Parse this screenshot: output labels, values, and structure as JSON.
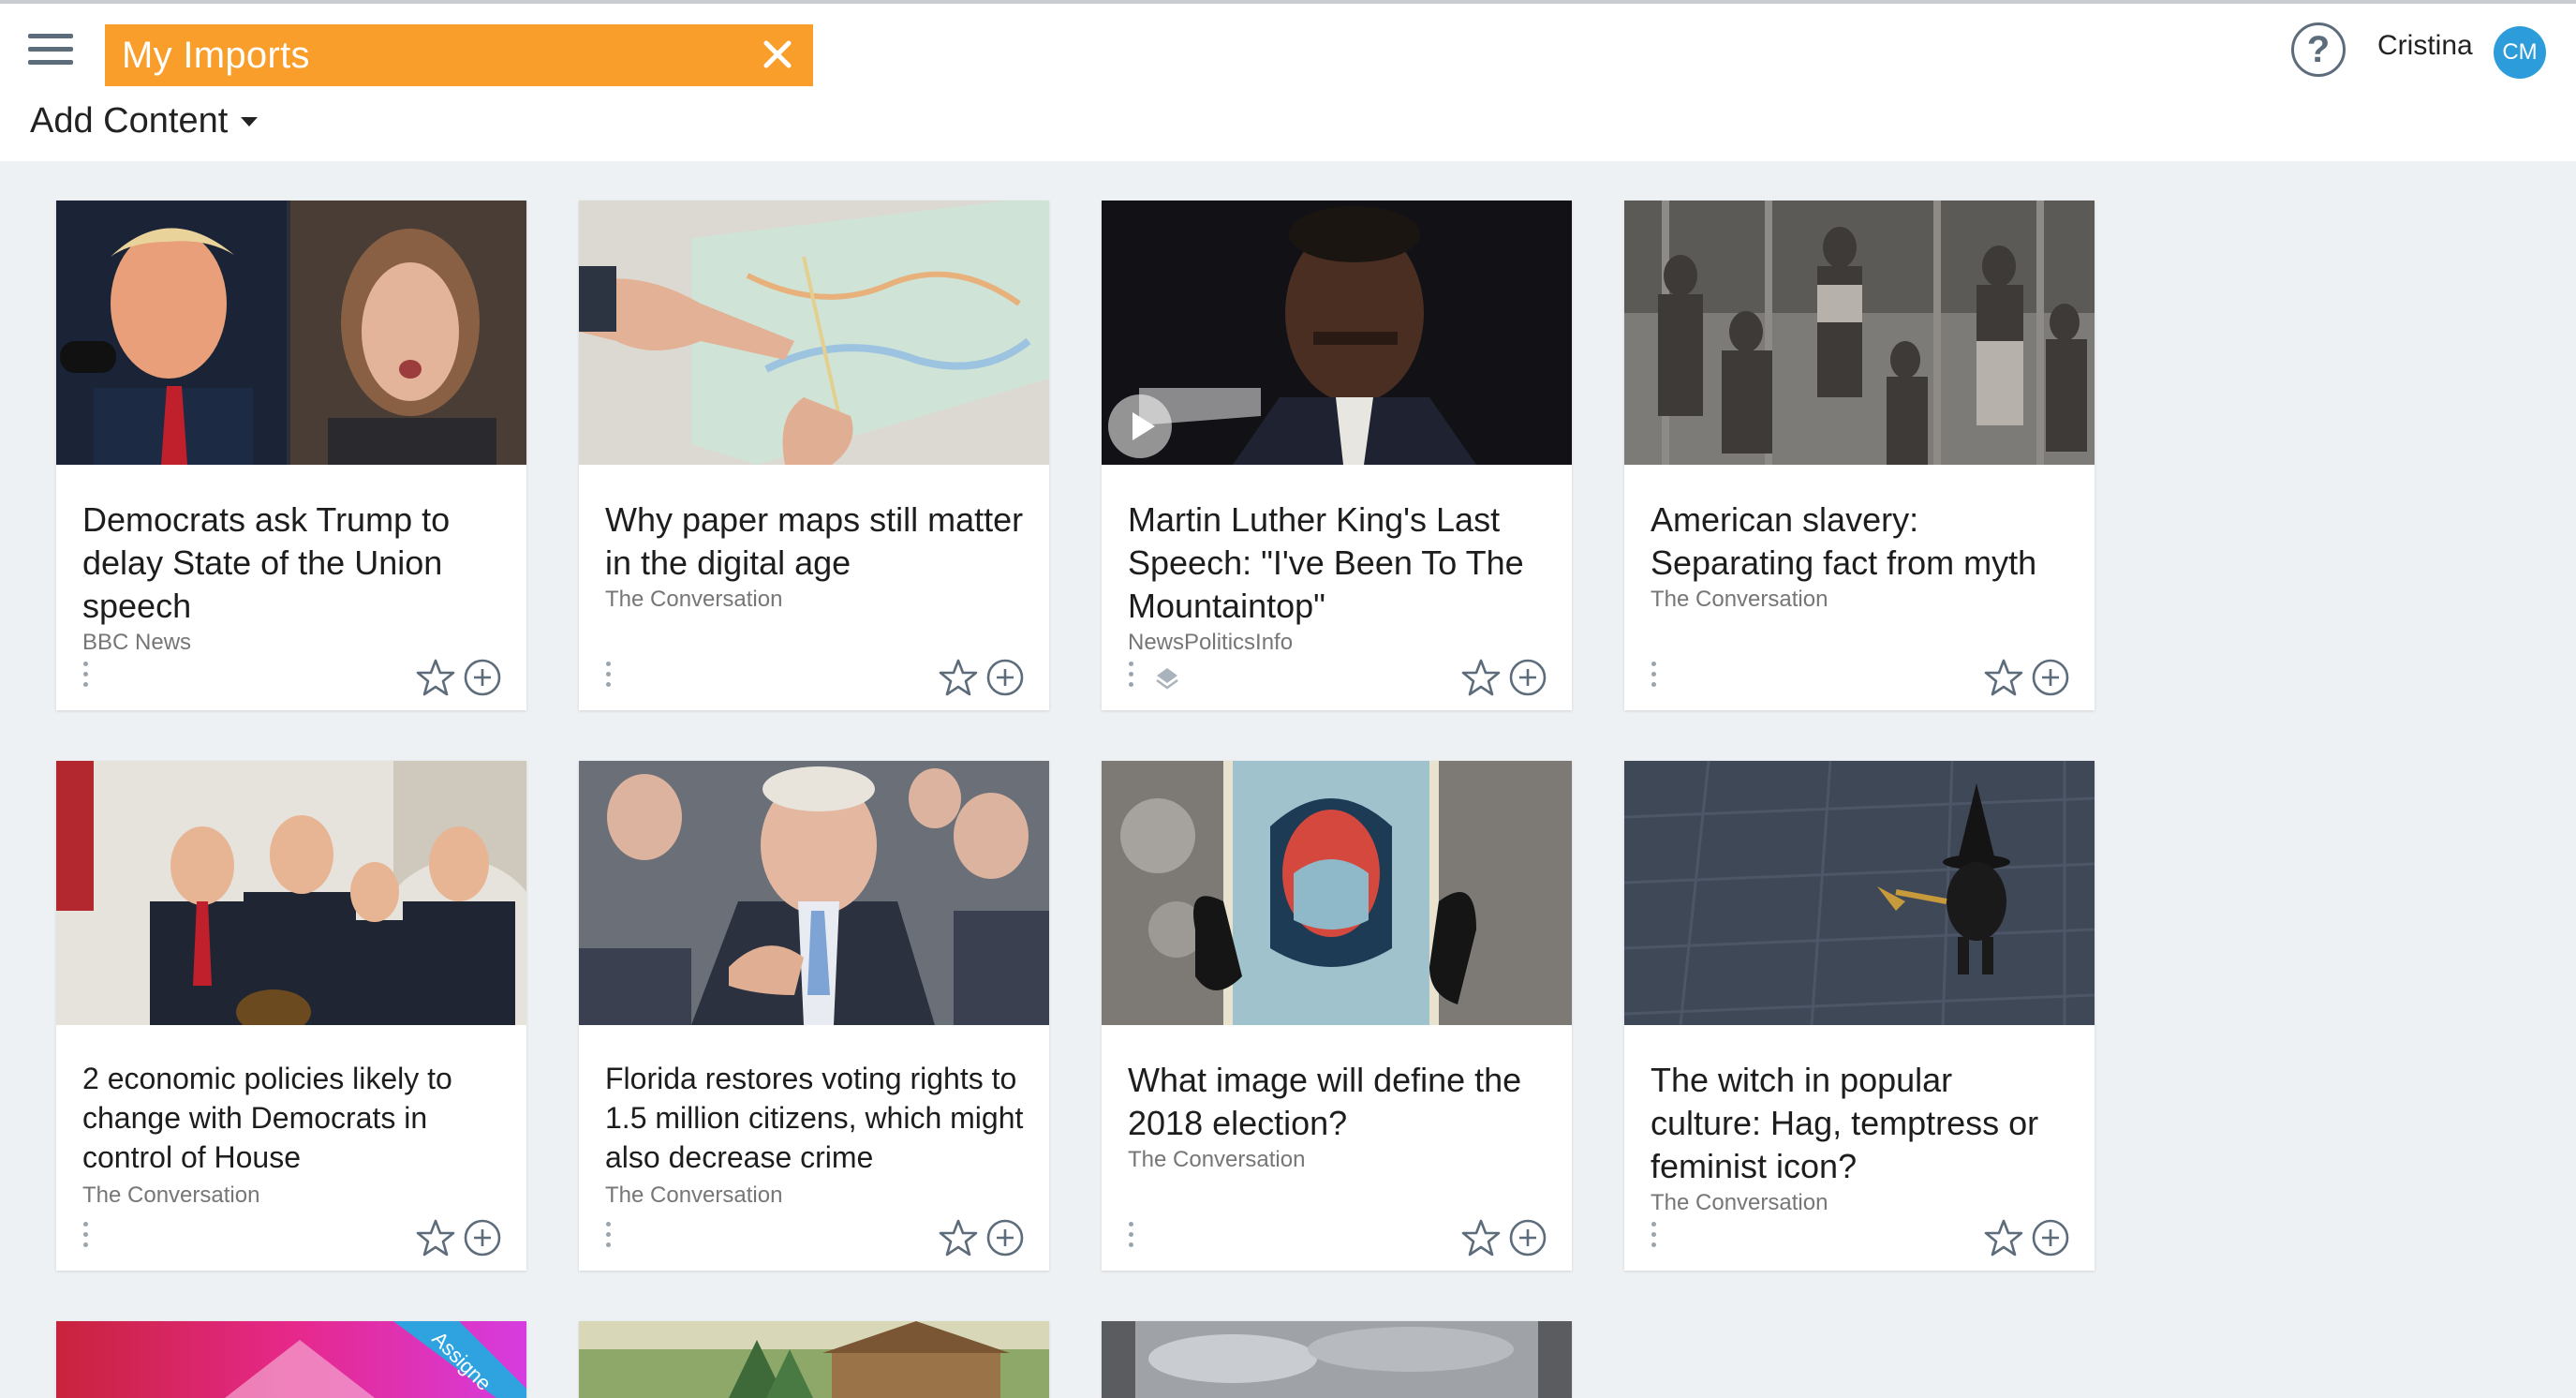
{
  "header": {
    "search_tag": "My Imports",
    "add_content_label": "Add Content",
    "help_label": "?",
    "user_name": "Cristina",
    "user_initials": "CM",
    "accent_color": "#f99e2b",
    "avatar_color": "#2d9cdb"
  },
  "cards": [
    {
      "title": "Democrats ask Trump to delay State of the Union speech",
      "source": "BBC News",
      "image": "trump-pelosi-photo"
    },
    {
      "title": "Why paper maps still matter in the digital age",
      "source": "The Conversation",
      "image": "paper-map-photo"
    },
    {
      "title": "Martin Luther King's Last Speech: \"I've Been To The Mountaintop\"",
      "source": "NewsPoliticsInfo",
      "image": "mlk-video-still"
    },
    {
      "title": "American slavery: Separating fact from myth",
      "source": "The Conversation",
      "image": "historical-group-photo"
    },
    {
      "title": "2 economic policies likely to change with Democrats in control of House",
      "source": "The Conversation",
      "image": "white-house-press-photo"
    },
    {
      "title": "Florida restores voting rights to 1.5 million citizens, which might also decrease crime",
      "source": "The Conversation",
      "image": "politician-speaking-photo"
    },
    {
      "title": "What image will define the 2018 election?",
      "source": "The Conversation",
      "image": "hope-poster-photo"
    },
    {
      "title": "The witch in popular culture: Hag, temptress or feminist icon?",
      "source": "The Conversation",
      "image": "child-witch-costume-photo"
    }
  ],
  "partial_cards": [
    {
      "image": "pink-assigned-thumbnail",
      "badge": "Assigne"
    },
    {
      "image": "log-cabin-painting"
    },
    {
      "image": "cloudy-sky-photo"
    }
  ]
}
